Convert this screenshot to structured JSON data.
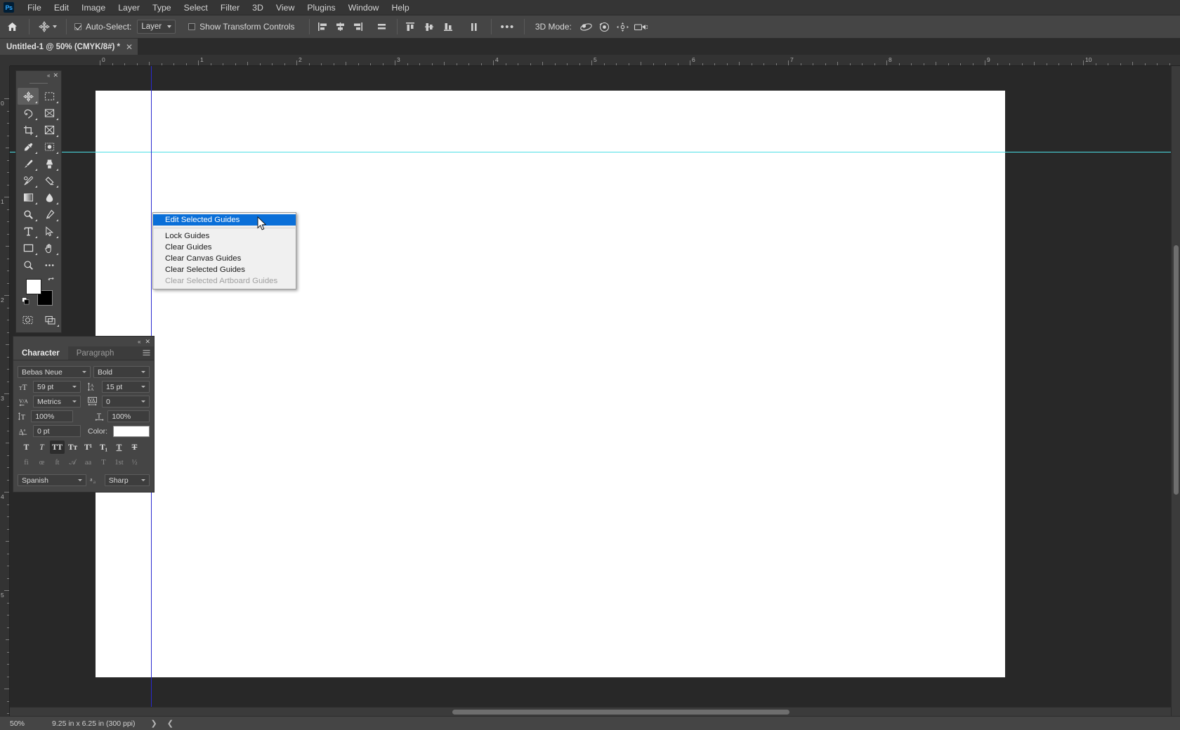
{
  "app": {
    "logo_text": "Ps"
  },
  "menubar": {
    "items": [
      "File",
      "Edit",
      "Image",
      "Layer",
      "Type",
      "Select",
      "Filter",
      "3D",
      "View",
      "Plugins",
      "Window",
      "Help"
    ]
  },
  "options_bar": {
    "home_icon": "home-icon",
    "tool_icon": "move-tool-icon",
    "auto_select_label": "Auto-Select:",
    "auto_select_checked": true,
    "auto_select_value": "Layer",
    "show_transform_label": "Show Transform Controls",
    "show_transform_checked": false,
    "align_icons": [
      "align-left-edges-icon",
      "align-horizontal-centers-icon",
      "align-right-edges-icon",
      "distribute-icon"
    ],
    "distribute_icons": [
      "align-top-edges-icon",
      "align-vertical-centers-icon",
      "align-bottom-edges-icon",
      "distribute-vertical-icon"
    ],
    "more_label": "•••",
    "mode3d_label": "3D Mode:",
    "mode3d_icons": [
      "orbit-3d-icon",
      "roll-3d-icon",
      "pan-3d-icon",
      "camera-3d-icon"
    ]
  },
  "document_tab": {
    "title": "Untitled-1 @ 50% (CMYK/8#) *",
    "close_icon": "close-icon"
  },
  "rulers": {
    "unit": "in",
    "horizontal_ticks": [
      "0",
      "1",
      "2",
      "3",
      "4",
      "5",
      "6",
      "7",
      "8",
      "9",
      "10"
    ],
    "vertical_ticks": [
      "0",
      "1",
      "2",
      "3",
      "4",
      "5"
    ]
  },
  "tools": {
    "collapse_icon": "chevron-double-left-icon",
    "close_icon": "close-icon",
    "items": [
      {
        "name": "move-tool",
        "selected": true
      },
      {
        "name": "rectangular-marquee-tool",
        "selected": false
      },
      {
        "name": "lasso-tool",
        "selected": false
      },
      {
        "name": "object-selection-tool",
        "selected": false
      },
      {
        "name": "crop-tool",
        "selected": false
      },
      {
        "name": "frame-tool",
        "selected": false
      },
      {
        "name": "eyedropper-tool",
        "selected": false
      },
      {
        "name": "spot-healing-brush-tool",
        "selected": false
      },
      {
        "name": "brush-tool",
        "selected": false
      },
      {
        "name": "clone-stamp-tool",
        "selected": false
      },
      {
        "name": "history-brush-tool",
        "selected": false
      },
      {
        "name": "eraser-tool",
        "selected": false
      },
      {
        "name": "gradient-tool",
        "selected": false
      },
      {
        "name": "blur-tool",
        "selected": false
      },
      {
        "name": "dodge-tool",
        "selected": false
      },
      {
        "name": "pen-tool",
        "selected": false
      },
      {
        "name": "type-tool",
        "selected": false
      },
      {
        "name": "path-selection-tool",
        "selected": false
      },
      {
        "name": "rectangle-tool",
        "selected": false
      },
      {
        "name": "hand-tool",
        "selected": false
      },
      {
        "name": "zoom-tool",
        "selected": false
      },
      {
        "name": "edit-toolbar-tool",
        "selected": false
      }
    ],
    "foreground_color": "#ffffff",
    "background_color": "#000000",
    "swap_icon": "swap-colors-icon",
    "default_icon": "default-colors-icon",
    "quick_mask_icon": "quick-mask-icon",
    "screen_mode_icon": "screen-mode-icon"
  },
  "character_panel": {
    "collapse_icon": "chevron-double-left-icon",
    "close_icon": "close-icon",
    "menu_icon": "panel-menu-icon",
    "tabs": [
      {
        "label": "Character",
        "active": true
      },
      {
        "label": "Paragraph",
        "active": false
      }
    ],
    "font_family": "Bebas Neue",
    "font_style": "Bold",
    "font_size": "59 pt",
    "font_size_icon": "font-size-icon",
    "leading": "15 pt",
    "leading_icon": "leading-icon",
    "kerning": "Metrics",
    "kerning_icon": "kerning-icon",
    "tracking": "0",
    "tracking_icon": "tracking-icon",
    "vertical_scale": "100%",
    "vertical_scale_icon": "vertical-scale-icon",
    "horizontal_scale": "100%",
    "horizontal_scale_icon": "horizontal-scale-icon",
    "baseline_shift": "0 pt",
    "baseline_shift_icon": "baseline-shift-icon",
    "color_label": "Color:",
    "color_value": "#ffffff",
    "style_buttons": [
      {
        "name": "faux-bold-button",
        "glyph": "T",
        "active": false,
        "style": "bold"
      },
      {
        "name": "faux-italic-button",
        "glyph": "T",
        "active": false,
        "style": "italic"
      },
      {
        "name": "all-caps-button",
        "glyph": "TT",
        "active": true,
        "style": "bold"
      },
      {
        "name": "small-caps-button",
        "glyph": "Tᴛ",
        "active": false,
        "style": "bold"
      },
      {
        "name": "superscript-button",
        "glyph": "T¹",
        "active": false,
        "style": "bold"
      },
      {
        "name": "subscript-button",
        "glyph": "T₁",
        "active": false,
        "style": "bold"
      },
      {
        "name": "underline-button",
        "glyph": "T",
        "active": false,
        "style": "underline"
      },
      {
        "name": "strikethrough-button",
        "glyph": "T",
        "active": false,
        "style": "strike"
      }
    ],
    "opentype_buttons": [
      {
        "name": "standard-ligatures-button",
        "glyph": "fi"
      },
      {
        "name": "contextual-alternates-button",
        "glyph": "œ"
      },
      {
        "name": "discretionary-ligatures-button",
        "glyph": "ſt"
      },
      {
        "name": "swash-button",
        "glyph": "𝒜"
      },
      {
        "name": "oldstyle-button",
        "glyph": "aa"
      },
      {
        "name": "stylistic-alternates-button",
        "glyph": "Т"
      },
      {
        "name": "ordinals-button",
        "glyph": "1st"
      },
      {
        "name": "fractions-button",
        "glyph": "½"
      }
    ],
    "language": "Spanish",
    "antialias_icon": "anti-alias-icon",
    "antialias": "Sharp"
  },
  "context_menu": {
    "items": [
      {
        "label": "Edit Selected Guides",
        "highlighted": true,
        "disabled": false,
        "separator_after": true
      },
      {
        "label": "Lock Guides",
        "highlighted": false,
        "disabled": false,
        "separator_after": false
      },
      {
        "label": "Clear Guides",
        "highlighted": false,
        "disabled": false,
        "separator_after": false
      },
      {
        "label": "Clear Canvas Guides",
        "highlighted": false,
        "disabled": false,
        "separator_after": false
      },
      {
        "label": "Clear Selected Guides",
        "highlighted": false,
        "disabled": false,
        "separator_after": false
      },
      {
        "label": "Clear Selected Artboard Guides",
        "highlighted": false,
        "disabled": true,
        "separator_after": false
      }
    ],
    "cursor_icon": "arrow-cursor-icon"
  },
  "status_bar": {
    "zoom": "50%",
    "dimensions": "9.25 in x 6.25 in (300 ppi)",
    "expand_icon": "chevron-right-icon",
    "collapse_icon": "chevron-left-icon"
  },
  "colors": {
    "panel_bg": "#454545",
    "menu_bg": "#353535",
    "canvas_bg": "#282828",
    "accent_blue": "#0a6fd8",
    "guide_cyan": "#4de0e6",
    "guide_blue": "#2a2ad0"
  }
}
